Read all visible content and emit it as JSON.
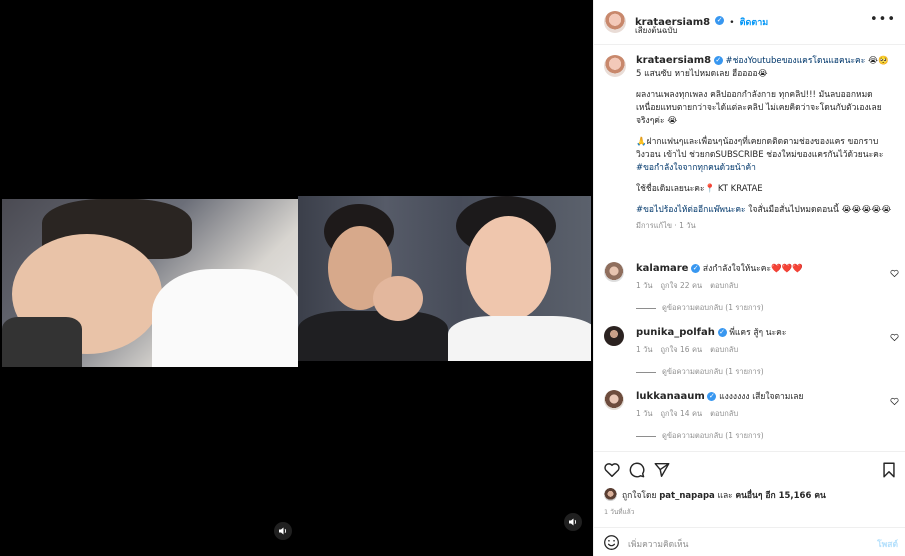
{
  "post_header": {
    "username": "krataersiam8",
    "follow_label": "ติดตาม",
    "subtitle": "เสียงต้นฉบับ",
    "more_icon": "more-horizontal-icon"
  },
  "caption": {
    "username": "krataersiam8",
    "line1_tag": "#ช่องYoutubeของแครโดนแฮคนะคะ",
    "line1_rest": " 😭🥺 5 แสนซับ หายไปหมดเลย ฮืออออ😭",
    "para2": "ผลงานเพลงทุกเพลง คลิปออกกำลังกาย ทุกคลิป!!! มันลบออกหมด เหนื่อยแทบตายกว่าจะได้แต่ละคลิป ไม่เคยคิดว่าจะโดนกับตัวเองเลย จริงๆค่ะ 😭",
    "para3_text": "🙏ฝากแฟนๆและเพื่อนๆน้องๆที่เคยกดติดตามช่องของแคร ขอกราบ วิงวอน เข้าไป ช่วยกดSUBSCRIBE ช่องใหม่ของแครกันไว้ด้วยนะคะ ",
    "para3_tag": "#ขอกำลังใจจากทุกคนด้วยน้าค้า",
    "para4": "ใช้ชื่อเดิมเลยนะคะ📍 KT KRATAE",
    "para5_tag": "#ขอไปร้องไห้ต่ออีกแพ๊พนะคะ",
    "para5_rest": " ใจสั่นมือสั่นไปหมดตอนนี้ 😭😭😭😭😭",
    "meta": "มีการแก้ไข · 1 วัน"
  },
  "comments": [
    {
      "username": "kalamare",
      "text": "ส่งกำลังใจให้นะคะ❤️❤️❤️",
      "time": "1 วัน",
      "likes": "ถูกใจ 22 คน",
      "reply": "ตอบกลับ",
      "replies": "ดูข้อความตอบกลับ (1 รายการ)"
    },
    {
      "username": "punika_polfah",
      "text": "พี่แคร สู้ๆ นะคะ",
      "time": "1 วัน",
      "likes": "ถูกใจ 16 คน",
      "reply": "ตอบกลับ",
      "replies": "ดูข้อความตอบกลับ (1 รายการ)"
    },
    {
      "username": "lukkanaaum",
      "text": "แงงงงงง เสียใจตามเลย",
      "time": "1 วัน",
      "likes": "ถูกใจ 14 คน",
      "reply": "ตอบกลับ",
      "replies": "ดูข้อความตอบกลับ (1 รายการ)"
    }
  ],
  "actions": {
    "likes_prefix": "ถูกใจโดย",
    "likes_user": "pat_napapa",
    "likes_and": "และ",
    "likes_others": "คนอื่นๆ อีก 15,166 คน",
    "date": "1 วันที่แล้ว"
  },
  "add_comment": {
    "placeholder": "เพิ่มความคิดเห็น",
    "post_label": "โพสต์"
  },
  "colors": {
    "link_blue": "#0095f6",
    "hashtag": "#00376b",
    "muted": "#8e8e8e"
  }
}
